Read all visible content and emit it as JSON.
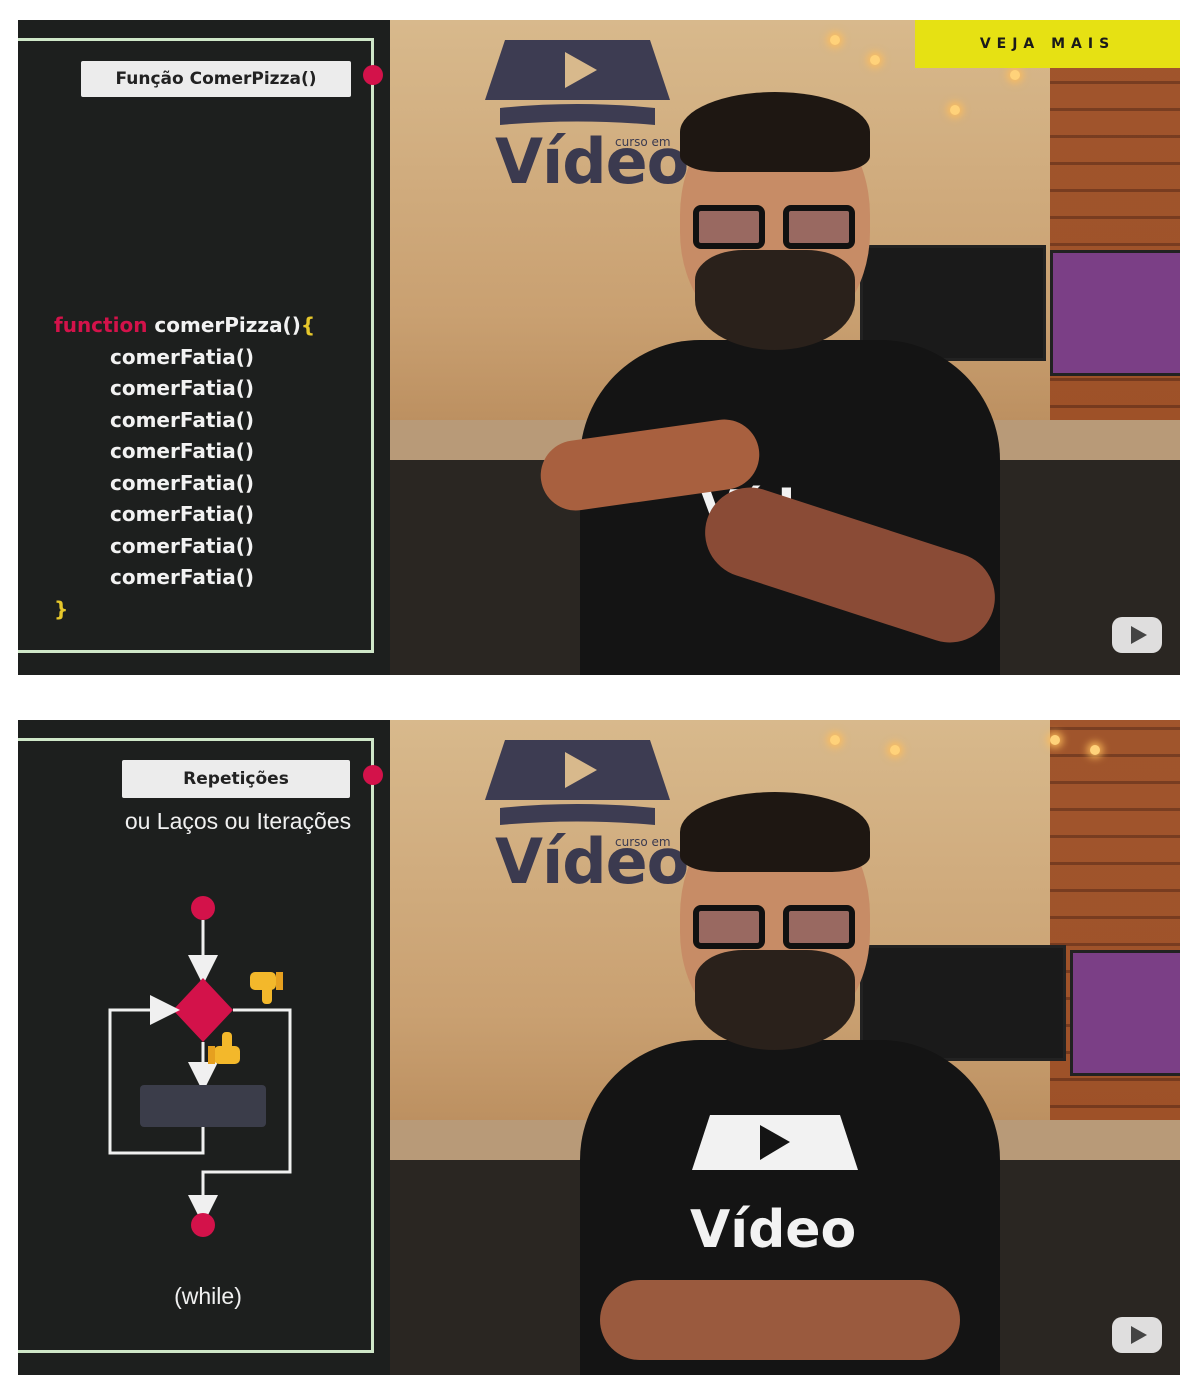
{
  "top_frame": {
    "panel_title": "Função ComerPizza()",
    "code": {
      "keyword": "function",
      "signature": "comerPizza()",
      "open_brace": "{",
      "lines": [
        "comerFatia()",
        "comerFatia()",
        "comerFatia()",
        "comerFatia()",
        "comerFatia()",
        "comerFatia()",
        "comerFatia()",
        "comerFatia()"
      ],
      "close_brace": "}"
    },
    "veja_mais": "VEJA MAIS"
  },
  "bottom_frame": {
    "panel_title": "Repetições",
    "subtitle": "ou Laços ou Iterações",
    "while_label": "(while)"
  },
  "brand": {
    "name": "Vídeo",
    "small": "curso em"
  },
  "colors": {
    "accent_red": "#d3124a",
    "accent_yellow": "#e6e113",
    "panel_bg": "#1d1f1e",
    "panel_border": "#cfe7c8"
  },
  "icons": [
    "thumbs-down-icon",
    "thumbs-up-icon",
    "youtube-play-icon"
  ]
}
